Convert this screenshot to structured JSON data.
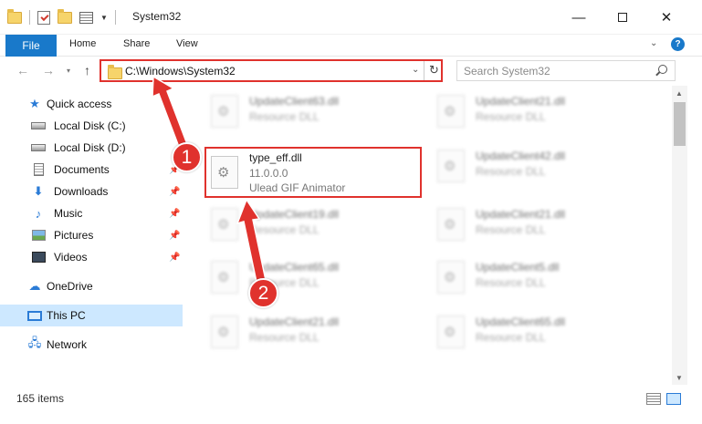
{
  "window": {
    "title": "System32",
    "minimize_glyph": "—",
    "close_glyph": "✕"
  },
  "ribbon": {
    "file": "File",
    "home": "Home",
    "share": "Share",
    "view": "View",
    "help": "?"
  },
  "navbar": {
    "back_glyph": "←",
    "forward_glyph": "→",
    "up_glyph": "↑",
    "address": "C:\\Windows\\System32",
    "search_placeholder": "Search System32"
  },
  "sidebar": {
    "items": [
      {
        "label": "Quick access",
        "icon": "star-icon"
      },
      {
        "label": "Local Disk (C:)",
        "icon": "disk-icon"
      },
      {
        "label": "Local Disk (D:)",
        "icon": "disk-icon"
      },
      {
        "label": "Documents",
        "icon": "documents-icon",
        "pinned": true
      },
      {
        "label": "Downloads",
        "icon": "download-icon",
        "pinned": true
      },
      {
        "label": "Music",
        "icon": "music-icon",
        "pinned": true
      },
      {
        "label": "Pictures",
        "icon": "pictures-icon",
        "pinned": true
      },
      {
        "label": "Videos",
        "icon": "videos-icon",
        "pinned": true
      },
      {
        "label": "OneDrive",
        "icon": "cloud-icon"
      },
      {
        "label": "This PC",
        "icon": "computer-icon",
        "selected": true
      },
      {
        "label": "Network",
        "icon": "network-icon"
      }
    ]
  },
  "files": {
    "highlighted": {
      "name": "type_eff.dll",
      "version": "11.0.0.0",
      "description": "Ulead GIF Animator"
    },
    "blurred": [
      {
        "name": "UpdateClient63.dll",
        "type": "Resource DLL"
      },
      {
        "name": "UpdateClient21.dll",
        "type": "Resource DLL"
      },
      {
        "name": "UpdateClient42.dll",
        "type": "Resource DLL"
      },
      {
        "name": "UpdateClient19.dll",
        "type": "Resource DLL"
      },
      {
        "name": "UpdateClient21.dll",
        "type": "Resource DLL"
      },
      {
        "name": "UpdateClient65.dll",
        "type": "Resource DLL"
      },
      {
        "name": "UpdateClient5.dll",
        "type": "Resource DLL"
      },
      {
        "name": "UpdateClient21.dll",
        "type": "Resource DLL"
      },
      {
        "name": "UpdateClient65.dll",
        "type": "Resource DLL"
      }
    ]
  },
  "status": {
    "item_count": "165 items"
  },
  "annotations": {
    "step1": "1",
    "step2": "2",
    "color": "#e0322d"
  }
}
